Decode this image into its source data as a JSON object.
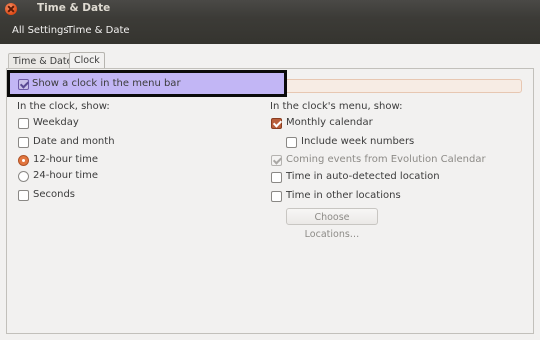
{
  "window": {
    "title": "Time & Date"
  },
  "toolbar": {
    "all_settings": "All Settings",
    "current": "Time & Date"
  },
  "tabs": [
    {
      "label": "Time & Date"
    },
    {
      "label": "Clock"
    }
  ],
  "show_clock": {
    "label": "Show a clock in the menu bar",
    "checked": true
  },
  "clock_section": {
    "heading": "In the clock, show:",
    "weekday": "Weekday",
    "date_month": "Date and month",
    "hour12": "12-hour time",
    "hour24": "24-hour time",
    "seconds": "Seconds"
  },
  "menu_section": {
    "heading": "In the clock's menu, show:",
    "monthly_calendar": "Monthly calendar",
    "week_numbers": "Include week numbers",
    "coming_events": "Coming events from Evolution Calendar",
    "auto_location": "Time in auto-detected location",
    "other_locations": "Time in other locations",
    "choose_button": "Choose Locations…"
  },
  "colors": {
    "accent": "#dd4814",
    "highlight": "#c2b6f5",
    "titlebar": "#3c3b37"
  }
}
